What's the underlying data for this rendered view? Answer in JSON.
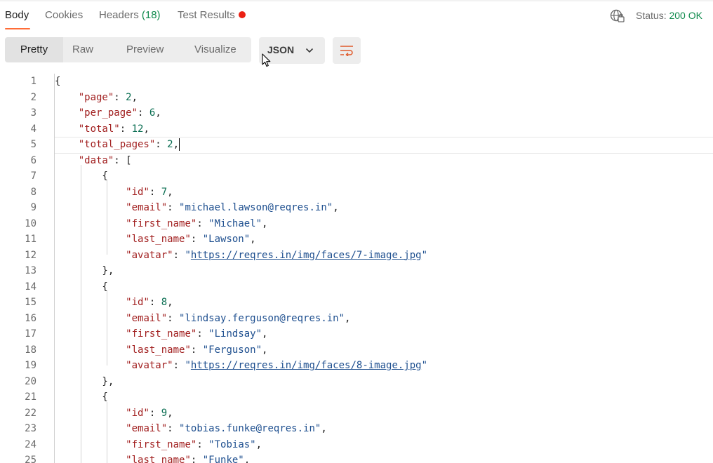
{
  "tabs": {
    "body": "Body",
    "cookies": "Cookies",
    "headers": "Headers",
    "headers_count": "(18)",
    "tests": "Test Results"
  },
  "status": {
    "label": "Status:",
    "code": "200 OK"
  },
  "toolbar": {
    "views": [
      "Pretty",
      "Raw",
      "Preview",
      "Visualize"
    ],
    "format": "JSON",
    "icons": [
      "globe-icon",
      "chevron-down-icon",
      "wrap-lines-icon"
    ]
  },
  "colors": {
    "accent": "#ff6c37",
    "success": "#0f8a4c",
    "error_dot": "#eb2013",
    "key": "#a11f1f",
    "string": "#1e4f8f",
    "number": "#0a6e52"
  },
  "editor": {
    "active_line": 5,
    "lines": [
      [
        {
          "t": "p",
          "v": "{"
        }
      ],
      [
        {
          "t": "p",
          "v": "    "
        },
        {
          "t": "k",
          "v": "\"page\""
        },
        {
          "t": "p",
          "v": ": "
        },
        {
          "t": "n",
          "v": "2"
        },
        {
          "t": "p",
          "v": ","
        }
      ],
      [
        {
          "t": "p",
          "v": "    "
        },
        {
          "t": "k",
          "v": "\"per_page\""
        },
        {
          "t": "p",
          "v": ": "
        },
        {
          "t": "n",
          "v": "6"
        },
        {
          "t": "p",
          "v": ","
        }
      ],
      [
        {
          "t": "p",
          "v": "    "
        },
        {
          "t": "k",
          "v": "\"total\""
        },
        {
          "t": "p",
          "v": ": "
        },
        {
          "t": "n",
          "v": "12"
        },
        {
          "t": "p",
          "v": ","
        }
      ],
      [
        {
          "t": "p",
          "v": "    "
        },
        {
          "t": "k",
          "v": "\"total_pages\""
        },
        {
          "t": "p",
          "v": ": "
        },
        {
          "t": "n",
          "v": "2"
        },
        {
          "t": "p",
          "v": ","
        },
        {
          "t": "caret",
          "v": ""
        }
      ],
      [
        {
          "t": "p",
          "v": "    "
        },
        {
          "t": "k",
          "v": "\"data\""
        },
        {
          "t": "p",
          "v": ": ["
        }
      ],
      [
        {
          "t": "p",
          "v": "        {"
        }
      ],
      [
        {
          "t": "p",
          "v": "            "
        },
        {
          "t": "k",
          "v": "\"id\""
        },
        {
          "t": "p",
          "v": ": "
        },
        {
          "t": "n",
          "v": "7"
        },
        {
          "t": "p",
          "v": ","
        }
      ],
      [
        {
          "t": "p",
          "v": "            "
        },
        {
          "t": "k",
          "v": "\"email\""
        },
        {
          "t": "p",
          "v": ": "
        },
        {
          "t": "s",
          "v": "\"michael.lawson@reqres.in\""
        },
        {
          "t": "p",
          "v": ","
        }
      ],
      [
        {
          "t": "p",
          "v": "            "
        },
        {
          "t": "k",
          "v": "\"first_name\""
        },
        {
          "t": "p",
          "v": ": "
        },
        {
          "t": "s",
          "v": "\"Michael\""
        },
        {
          "t": "p",
          "v": ","
        }
      ],
      [
        {
          "t": "p",
          "v": "            "
        },
        {
          "t": "k",
          "v": "\"last_name\""
        },
        {
          "t": "p",
          "v": ": "
        },
        {
          "t": "s",
          "v": "\"Lawson\""
        },
        {
          "t": "p",
          "v": ","
        }
      ],
      [
        {
          "t": "p",
          "v": "            "
        },
        {
          "t": "k",
          "v": "\"avatar\""
        },
        {
          "t": "p",
          "v": ": "
        },
        {
          "t": "s",
          "v": "\""
        },
        {
          "t": "u",
          "v": "https://reqres.in/img/faces/7-image.jpg"
        },
        {
          "t": "s",
          "v": "\""
        }
      ],
      [
        {
          "t": "p",
          "v": "        },"
        }
      ],
      [
        {
          "t": "p",
          "v": "        {"
        }
      ],
      [
        {
          "t": "p",
          "v": "            "
        },
        {
          "t": "k",
          "v": "\"id\""
        },
        {
          "t": "p",
          "v": ": "
        },
        {
          "t": "n",
          "v": "8"
        },
        {
          "t": "p",
          "v": ","
        }
      ],
      [
        {
          "t": "p",
          "v": "            "
        },
        {
          "t": "k",
          "v": "\"email\""
        },
        {
          "t": "p",
          "v": ": "
        },
        {
          "t": "s",
          "v": "\"lindsay.ferguson@reqres.in\""
        },
        {
          "t": "p",
          "v": ","
        }
      ],
      [
        {
          "t": "p",
          "v": "            "
        },
        {
          "t": "k",
          "v": "\"first_name\""
        },
        {
          "t": "p",
          "v": ": "
        },
        {
          "t": "s",
          "v": "\"Lindsay\""
        },
        {
          "t": "p",
          "v": ","
        }
      ],
      [
        {
          "t": "p",
          "v": "            "
        },
        {
          "t": "k",
          "v": "\"last_name\""
        },
        {
          "t": "p",
          "v": ": "
        },
        {
          "t": "s",
          "v": "\"Ferguson\""
        },
        {
          "t": "p",
          "v": ","
        }
      ],
      [
        {
          "t": "p",
          "v": "            "
        },
        {
          "t": "k",
          "v": "\"avatar\""
        },
        {
          "t": "p",
          "v": ": "
        },
        {
          "t": "s",
          "v": "\""
        },
        {
          "t": "u",
          "v": "https://reqres.in/img/faces/8-image.jpg"
        },
        {
          "t": "s",
          "v": "\""
        }
      ],
      [
        {
          "t": "p",
          "v": "        },"
        }
      ],
      [
        {
          "t": "p",
          "v": "        {"
        }
      ],
      [
        {
          "t": "p",
          "v": "            "
        },
        {
          "t": "k",
          "v": "\"id\""
        },
        {
          "t": "p",
          "v": ": "
        },
        {
          "t": "n",
          "v": "9"
        },
        {
          "t": "p",
          "v": ","
        }
      ],
      [
        {
          "t": "p",
          "v": "            "
        },
        {
          "t": "k",
          "v": "\"email\""
        },
        {
          "t": "p",
          "v": ": "
        },
        {
          "t": "s",
          "v": "\"tobias.funke@reqres.in\""
        },
        {
          "t": "p",
          "v": ","
        }
      ],
      [
        {
          "t": "p",
          "v": "            "
        },
        {
          "t": "k",
          "v": "\"first_name\""
        },
        {
          "t": "p",
          "v": ": "
        },
        {
          "t": "s",
          "v": "\"Tobias\""
        },
        {
          "t": "p",
          "v": ","
        }
      ],
      [
        {
          "t": "p",
          "v": "            "
        },
        {
          "t": "k",
          "v": "\"last_name\""
        },
        {
          "t": "p",
          "v": ": "
        },
        {
          "t": "s",
          "v": "\"Funke\""
        },
        {
          "t": "p",
          "v": ","
        }
      ]
    ]
  }
}
